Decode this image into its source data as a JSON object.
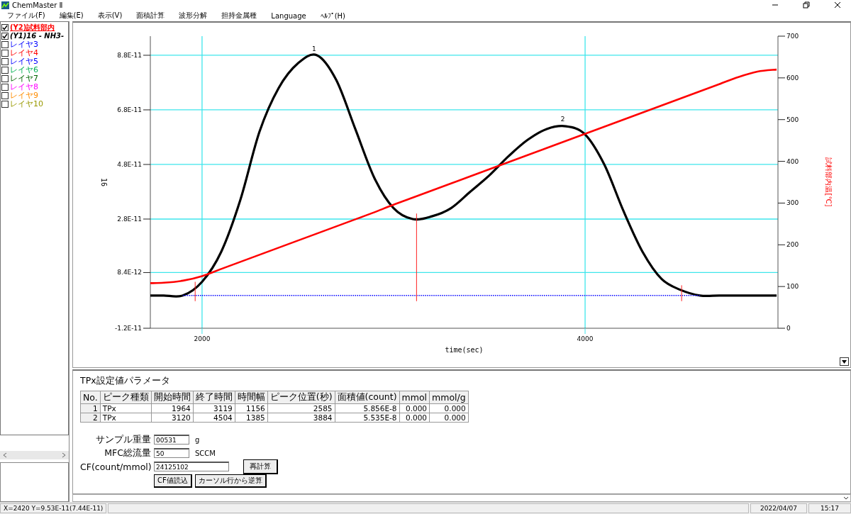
{
  "window": {
    "title": "ChemMaster Ⅱ"
  },
  "menu": [
    "ファイル(F)",
    "編集(E)",
    "表示(V)",
    "面積計算",
    "波形分解",
    "担持金属種",
    "Language",
    "ﾍﾙﾌﾟ(H)"
  ],
  "layers": [
    {
      "label": "(Y2)試料部内",
      "kind": "y2",
      "checked": true,
      "color": "#ff0000"
    },
    {
      "label": "(Y1)16 - NH3-",
      "kind": "y1",
      "checked": true,
      "color": "#000000"
    },
    {
      "label": "レイヤ3",
      "kind": "layer",
      "checked": false,
      "color": "#0000ff"
    },
    {
      "label": "レイヤ4",
      "kind": "layer",
      "checked": false,
      "color": "#ff0000"
    },
    {
      "label": "レイヤ5",
      "kind": "layer",
      "checked": false,
      "color": "#0000ff"
    },
    {
      "label": "レイヤ6",
      "kind": "layer",
      "checked": false,
      "color": "#00b050"
    },
    {
      "label": "レイヤ7",
      "kind": "layer",
      "checked": false,
      "color": "#006400"
    },
    {
      "label": "レイヤ8",
      "kind": "layer",
      "checked": false,
      "color": "#ff00ff"
    },
    {
      "label": "レイヤ9",
      "kind": "layer",
      "checked": false,
      "color": "#ff8c00"
    },
    {
      "label": "レイヤ10",
      "kind": "layer",
      "checked": false,
      "color": "#999900"
    }
  ],
  "chart": {
    "chart_data": {
      "type": "line",
      "xlabel": "time(sec)",
      "ylabel": "16",
      "y2label": "試料部内温[℃]",
      "x": [
        1730,
        1800,
        1900,
        2000,
        2100,
        2200,
        2300,
        2400,
        2500,
        2600,
        2700,
        2800,
        2900,
        3000,
        3100,
        3200,
        3300,
        3400,
        3500,
        3600,
        3700,
        3800,
        3900,
        4000,
        4100,
        4200,
        4300,
        4400,
        4500,
        4600,
        4700,
        4800,
        4900,
        5000
      ],
      "xlim": [
        1730,
        5007
      ],
      "ylim": [
        -1.2e-11,
        9.5e-11
      ],
      "y2lim": [
        0,
        700
      ],
      "xticks": [
        2000,
        4000
      ],
      "grid": true,
      "yticks": [
        {
          "value": 8.8e-11,
          "label": "8.8E-11"
        },
        {
          "value": 6.8e-11,
          "label": "6.8E-11"
        },
        {
          "value": 4.8e-11,
          "label": "4.8E-11"
        },
        {
          "value": 2.8e-11,
          "label": "2.8E-11"
        },
        {
          "value": 8.4e-12,
          "label": "8.4E-12"
        },
        {
          "value": -1.2e-11,
          "label": "-1.2E-11"
        }
      ],
      "y2ticks": [
        0,
        100,
        200,
        300,
        400,
        500,
        600,
        700
      ],
      "series": [
        {
          "color": "#000000",
          "values": [
            0,
            0,
            0,
            5e-12,
            1.6e-11,
            3.5e-11,
            6e-11,
            7.6e-11,
            8.5e-11,
            8.8e-11,
            7.9e-11,
            6.1e-11,
            4.3e-11,
            3.2e-11,
            2.8e-11,
            2.9e-11,
            3.2e-11,
            3.8e-11,
            4.4e-11,
            5.1e-11,
            5.7e-11,
            6.1e-11,
            6.2e-11,
            5.9e-11,
            4.8e-11,
            3.1e-11,
            1.6e-11,
            6e-12,
            2e-12,
            0,
            0,
            0,
            0,
            0
          ]
        },
        {
          "color": "#ff0000",
          "axis": "y2",
          "values": [
            108,
            109,
            114,
            125,
            142,
            159,
            176,
            193,
            210,
            227,
            244,
            261,
            278,
            296,
            313,
            330,
            347,
            364,
            381,
            398,
            415,
            432,
            449,
            466,
            483,
            500,
            517,
            534,
            551,
            568,
            585,
            602,
            615,
            620
          ]
        },
        {
          "color": "#0000ff",
          "line_style": "dotted",
          "values": [
            null,
            null,
            0,
            0,
            0,
            0,
            0,
            0,
            0,
            0,
            0,
            0,
            0,
            0,
            0,
            0,
            0,
            0,
            0,
            0,
            0,
            0,
            0,
            0,
            0,
            0,
            0,
            0,
            0,
            0,
            null,
            null,
            null,
            null
          ]
        }
      ],
      "annotations": [
        "1",
        "2"
      ]
    }
  },
  "params": {
    "title": "TPx設定値パラメータ",
    "columns": [
      "No.",
      "ピーク種類",
      "開始時間",
      "終了時間",
      "時間幅",
      "ピーク位置(秒)",
      "面積値(count)",
      "mmol",
      "mmol/g"
    ],
    "rows": [
      [
        "1",
        "TPx",
        "1964",
        "3119",
        "1156",
        "2585",
        "5.856E-8",
        "0.000",
        "0.000"
      ],
      [
        "2",
        "TPx",
        "3120",
        "4504",
        "1385",
        "3884",
        "5.535E-8",
        "0.000",
        "0.000"
      ]
    ],
    "fields": [
      {
        "label": "サンプル重量",
        "value": "00531",
        "unit": "g"
      },
      {
        "label": "MFC総流量",
        "value": "50",
        "unit": "SCCM"
      },
      {
        "label": "CF(count/mmol)",
        "value": "24125102"
      }
    ],
    "recalc_button": "再計算",
    "buttons": [
      "CF値読込",
      "カーソル行から逆算"
    ]
  },
  "status_bar": {
    "cursor": "X=2420 Y=9.53E-11(7.44E-11)",
    "date": "2022/04/07",
    "time": "15:17"
  }
}
